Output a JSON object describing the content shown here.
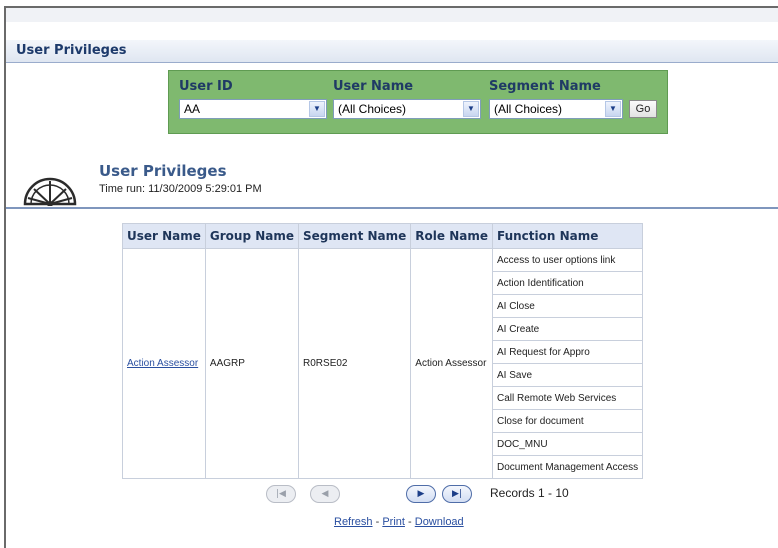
{
  "page": {
    "section_title": "User Privileges"
  },
  "filters": {
    "user_id": {
      "label": "User ID",
      "value": "AA"
    },
    "user_name": {
      "label": "User Name",
      "value": "(All Choices)"
    },
    "segment_name": {
      "label": "Segment Name",
      "value": "(All Choices)"
    },
    "go_label": "Go"
  },
  "report": {
    "title": "User Privileges",
    "time_run": "Time run: 11/30/2009 5:29:01 PM"
  },
  "table": {
    "columns": [
      "User Name",
      "Group Name",
      "Segment Name",
      "Role Name",
      "Function Name"
    ],
    "user_name": "Action Assessor",
    "group_name": "AAGRP",
    "segment_name": "R0RSE02",
    "role_name": "Action Assessor",
    "functions": [
      "Access to user options link",
      "Action Identification",
      "AI Close",
      "AI Create",
      "AI Request for Appro",
      "AI Save",
      "Call Remote Web Services",
      "Close for document",
      "DOC_MNU",
      "Document Management Access"
    ]
  },
  "pager": {
    "records_label": "Records 1 - 10",
    "first_icon": "first-page-icon",
    "prev_icon": "previous-page-icon",
    "next_icon": "next-page-icon",
    "last_icon": "last-page-icon"
  },
  "links": {
    "refresh": "Refresh",
    "print": "Print",
    "download": "Download",
    "separator": "-"
  },
  "colors": {
    "filter_bg": "#7fb96f",
    "header_bg": "#dfe6f4",
    "title": "#1d3a6b",
    "link": "#2a4fa0"
  }
}
